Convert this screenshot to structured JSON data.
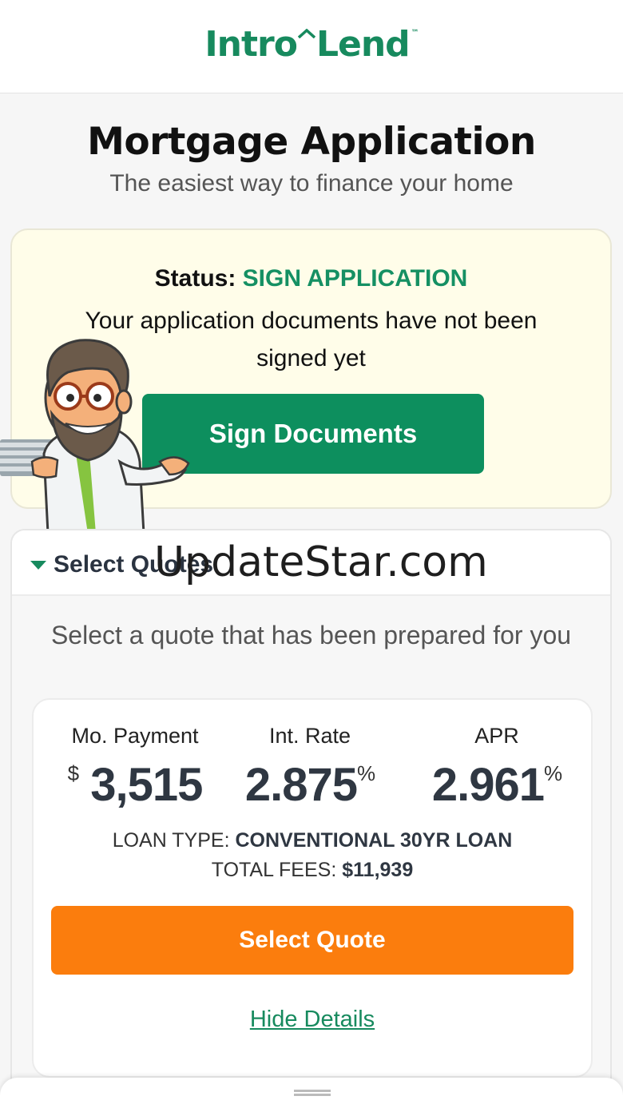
{
  "header": {
    "logo_text_left": "Intro",
    "logo_text_right": "Lend",
    "logo_tm": "™"
  },
  "page": {
    "title": "Mortgage Application",
    "subtitle": "The easiest way to finance your home"
  },
  "status": {
    "label": "Status:",
    "value": "SIGN APPLICATION",
    "message": "Your application documents have not been signed yet",
    "button_label": "Sign Documents"
  },
  "quotes": {
    "section_title": "Select Quotes",
    "watermark": "UpdateStar.com",
    "intro": "Select a quote that has been prepared for you",
    "card": {
      "payment_label": "Mo. Payment",
      "payment_currency": "$",
      "payment_value": "3,515",
      "rate_label": "Int. Rate",
      "rate_value": "2.875",
      "rate_unit": "%",
      "apr_label": "APR",
      "apr_value": "2.961",
      "apr_unit": "%",
      "loan_type_label": "LOAN TYPE:",
      "loan_type_value": "CONVENTIONAL 30YR LOAN",
      "fees_label": "TOTAL FEES:",
      "fees_value": "$11,939",
      "select_button": "Select Quote",
      "hide_link": "Hide Details"
    }
  },
  "colors": {
    "brand_green": "#178a5e",
    "button_green": "#0d8f5e",
    "orange": "#fb7d0d",
    "status_bg": "#fffde9"
  }
}
